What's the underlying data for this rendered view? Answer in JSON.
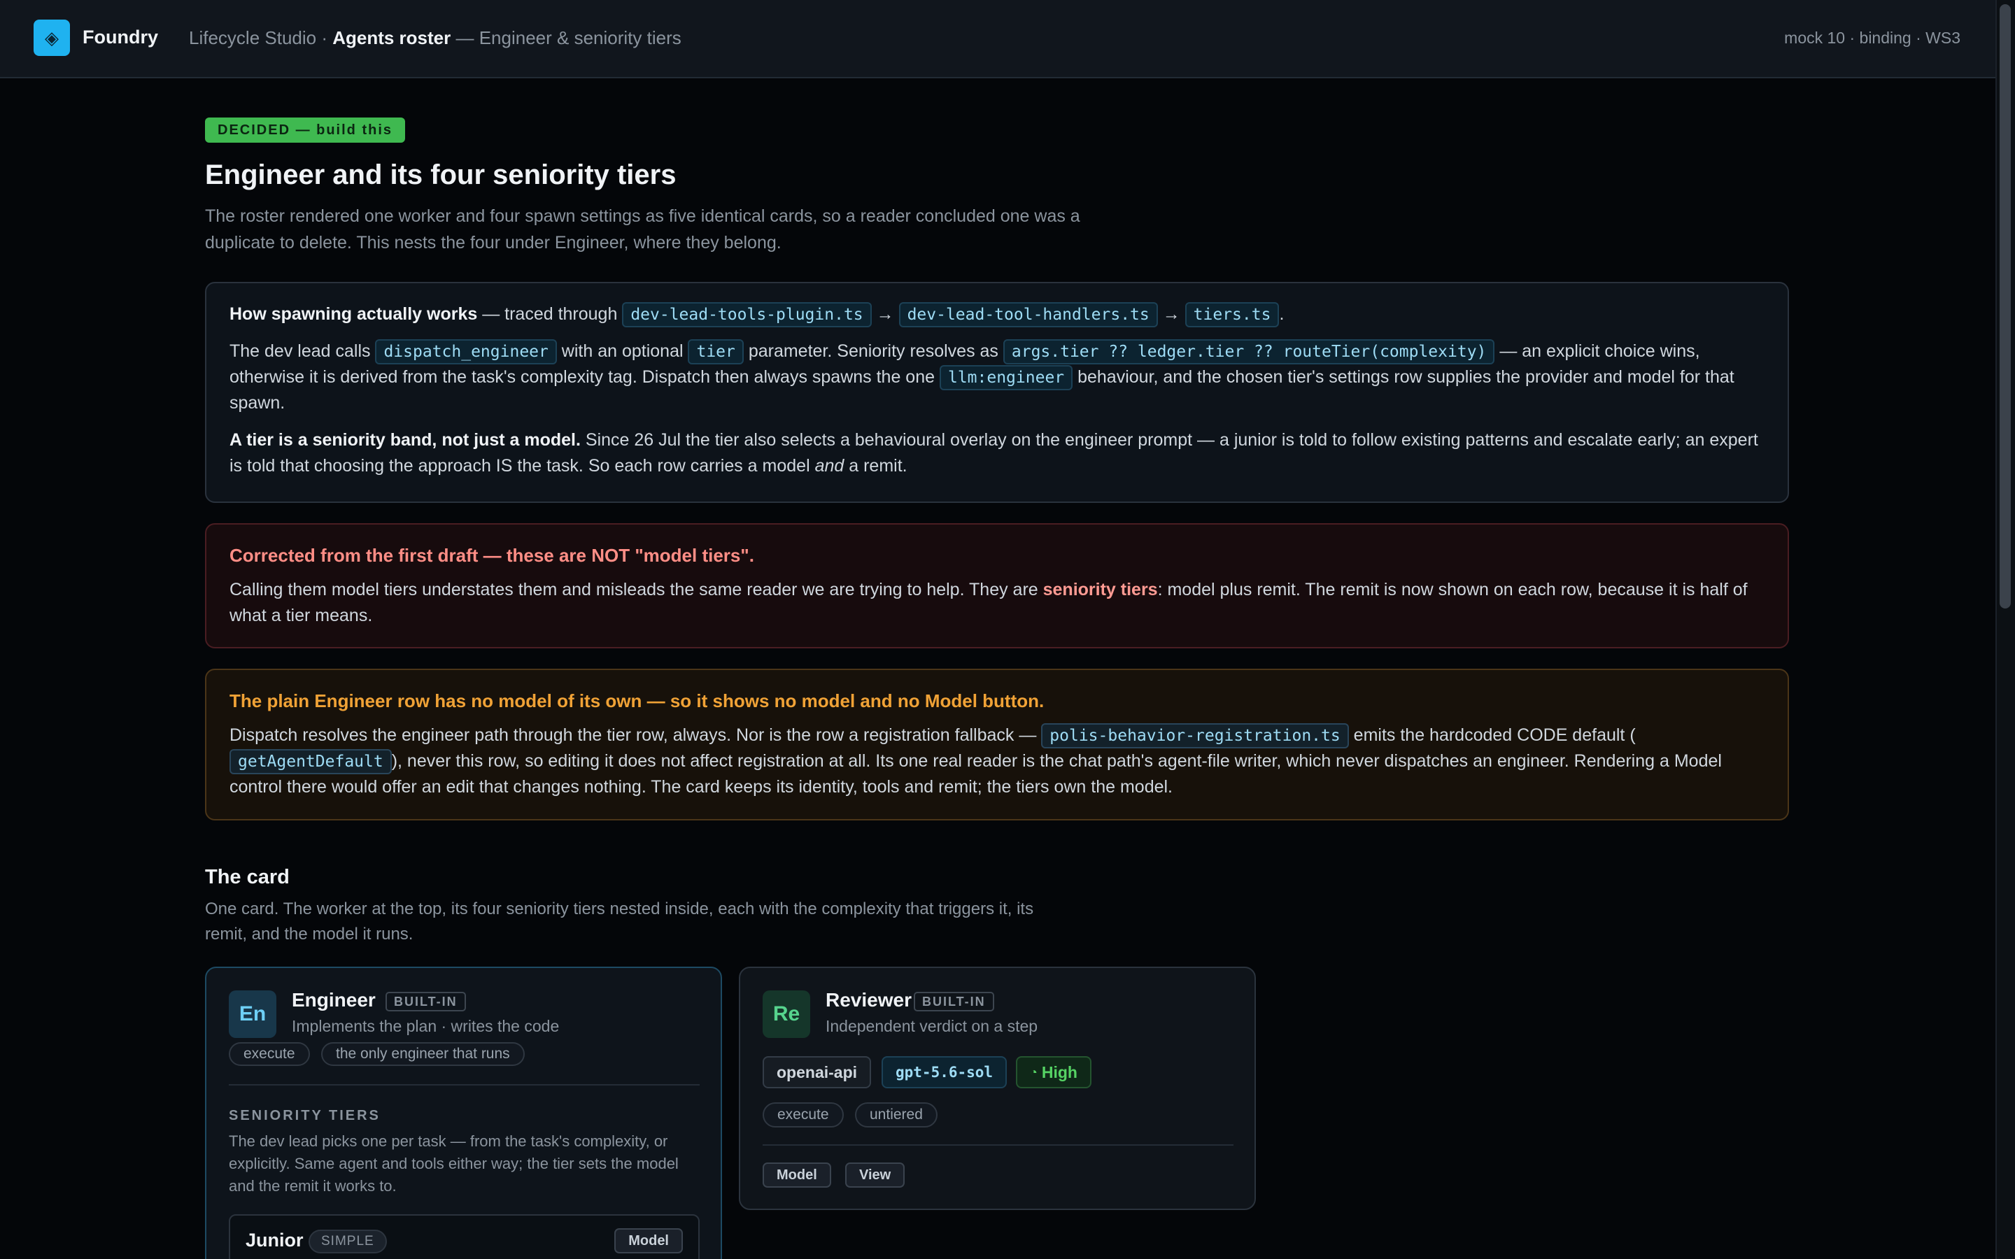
{
  "topbar": {
    "brand": "Foundry",
    "crumb_prefix": "Lifecycle Studio · ",
    "crumb_current": "Agents roster",
    "crumb_suffix": " — Engineer & seniority tiers",
    "meta": "mock 10 · binding · WS3"
  },
  "header": {
    "badge": "DECIDED — build this",
    "title": "Engineer and its four seniority tiers",
    "lead": "The roster rendered one worker and four spawn settings as five identical cards, so a reader concluded one was a duplicate to delete. This nests the four under Engineer, where they belong."
  },
  "info": {
    "l1_bold": "How spawning actually works",
    "l1_text": " — traced through ",
    "file1": "dev-lead-tools-plugin.ts",
    "arrow": " → ",
    "file2": "dev-lead-tool-handlers.ts",
    "file3": "tiers.ts",
    "period": ".",
    "p2_a": "The dev lead calls ",
    "code_dispatch": "dispatch_engineer",
    "p2_b": " with an optional ",
    "code_tier": "tier",
    "p2_c": " parameter. Seniority resolves as ",
    "code_expr": "args.tier ?? ledger.tier ?? routeTier(complexity)",
    "p2_d": " — an explicit choice wins, otherwise it is derived from the task's complexity tag. Dispatch then always spawns the one ",
    "code_llm": "llm:engineer",
    "p2_e": " behaviour, and the chosen tier's settings row supplies the provider and model for that spawn.",
    "p3_bold": "A tier is a seniority band, not just a model.",
    "p3_a": " Since 26 Jul the tier also selects a behavioural overlay on the engineer prompt — a junior is told to follow existing patterns and escalate early; an expert is told that choosing the approach IS the task. So each row carries a model ",
    "p3_em": "and",
    "p3_b": " a remit."
  },
  "correction": {
    "title": "Corrected from the first draft — these are NOT \"model tiers\".",
    "a": "Calling them model tiers understates them and misleads the same reader we are trying to help. They are ",
    "hl": "seniority tiers",
    "b": ": model plus remit. The remit is now shown on each row, because it is half of what a tier means."
  },
  "warning": {
    "title": "The plain Engineer row has no model of its own — so it shows no model and no Model button.",
    "a": "Dispatch resolves the engineer path through the tier row, always. Nor is the row a registration fallback — ",
    "code_reg": "polis-behavior-registration.ts",
    "b": " emits the hardcoded CODE default (",
    "code_get": "getAgentDefault",
    "c": "), never this row, so editing it does not affect registration at all. Its one real reader is the chat path's agent-file writer, which never dispatches an engineer. Rendering a Model control there would offer an edit that changes nothing. The card keeps its identity, tools and remit; the tiers own the model."
  },
  "section": {
    "title": "The card",
    "subtitle": "One card. The worker at the top, its four seniority tiers nested inside, each with the complexity that triggers it, its remit, and the model it runs."
  },
  "engineer_card": {
    "avatar": "En",
    "name": "Engineer",
    "badge": "BUILT-IN",
    "desc": "Implements the plan · writes the code",
    "chip1": "execute",
    "chip2": "the only engineer that runs",
    "tiers_heading": "SENIORITY TIERS",
    "tiers_desc": "The dev lead picks one per task — from the task's complexity, or explicitly. Same agent and tools either way; the tier sets the model and the remit it works to.",
    "tier": {
      "name": "Junior",
      "complexity": "SIMPLE",
      "button": "Model"
    }
  },
  "reviewer_card": {
    "avatar": "Re",
    "name": "Reviewer",
    "badge": "BUILT-IN",
    "desc": "Independent verdict on a step",
    "provider": "openai-api",
    "model": "gpt-5.6-sol",
    "effort": "High",
    "chip1": "execute",
    "chip2": "untiered",
    "btn_model": "Model",
    "btn_view": "View"
  },
  "colors": {
    "accent": "#1fb2f0",
    "decided": "#3fb950",
    "error_title": "#ff8e86",
    "warning_title": "#f0a236",
    "effort": "#56d364"
  },
  "icons": {
    "logo": "diamond-logo-icon",
    "effort": "gauge-icon"
  }
}
